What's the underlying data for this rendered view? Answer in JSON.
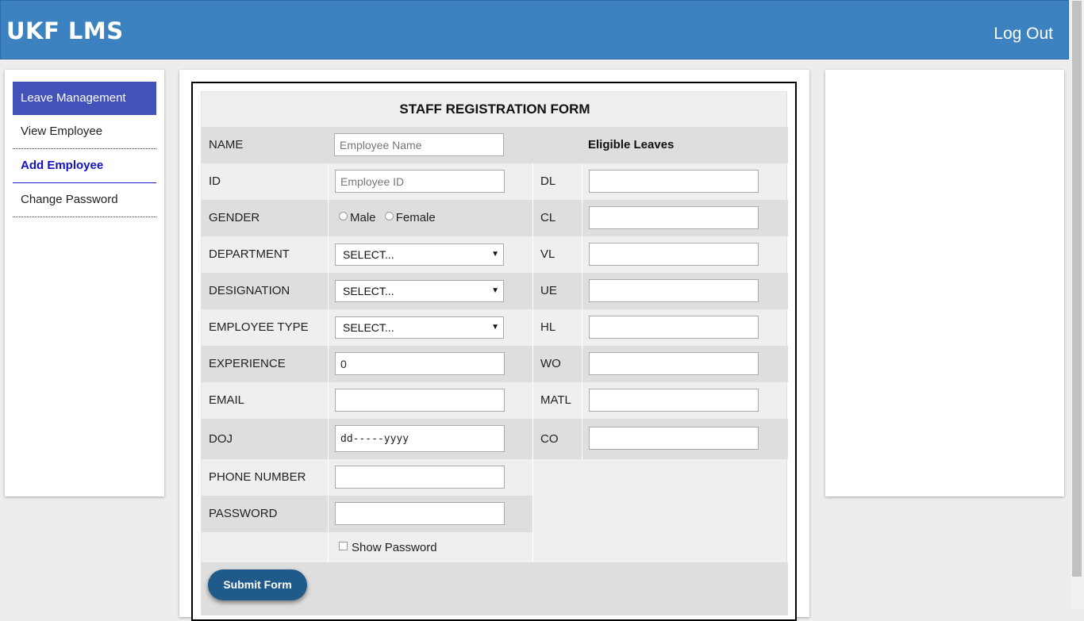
{
  "header": {
    "brand": "UKF LMS",
    "logout_label": "Log Out"
  },
  "sidebar": {
    "items": [
      {
        "label": "Leave Management"
      },
      {
        "label": "View Employee"
      },
      {
        "label": "Add Employee"
      },
      {
        "label": "Change Password"
      }
    ]
  },
  "form": {
    "title": "STAFF REGISTRATION FORM",
    "eligible_header": "Eligible Leaves",
    "name": {
      "label": "NAME",
      "placeholder": "Employee Name",
      "value": ""
    },
    "id": {
      "label": "ID",
      "placeholder": "Employee ID",
      "value": ""
    },
    "gender": {
      "label": "GENDER",
      "options": [
        "Male",
        "Female"
      ]
    },
    "department": {
      "label": "DEPARTMENT",
      "selected": "SELECT..."
    },
    "designation": {
      "label": "DESIGNATION",
      "selected": "SELECT..."
    },
    "employee_type": {
      "label": "EMPLOYEE TYPE",
      "selected": "SELECT..."
    },
    "experience": {
      "label": "EXPERIENCE",
      "value": "0"
    },
    "email": {
      "label": "EMAIL",
      "value": ""
    },
    "doj": {
      "label": "DOJ",
      "value": "dd-----yyyy"
    },
    "phone": {
      "label": "PHONE NUMBER",
      "value": ""
    },
    "password": {
      "label": "PASSWORD",
      "value": ""
    },
    "show_password_label": "Show Password",
    "leaves": [
      {
        "code": "DL",
        "value": ""
      },
      {
        "code": "CL",
        "value": ""
      },
      {
        "code": "VL",
        "value": ""
      },
      {
        "code": "UE",
        "value": ""
      },
      {
        "code": "HL",
        "value": ""
      },
      {
        "code": "WO",
        "value": ""
      },
      {
        "code": "MATL",
        "value": ""
      },
      {
        "code": "CO",
        "value": ""
      }
    ],
    "submit_label": "Submit Form"
  },
  "colors": {
    "header_bg": "#3c82c0",
    "nav_active_bg": "#4352bb",
    "nav_current_text": "#1212c4",
    "submit_bg": "#1f5a8a"
  }
}
